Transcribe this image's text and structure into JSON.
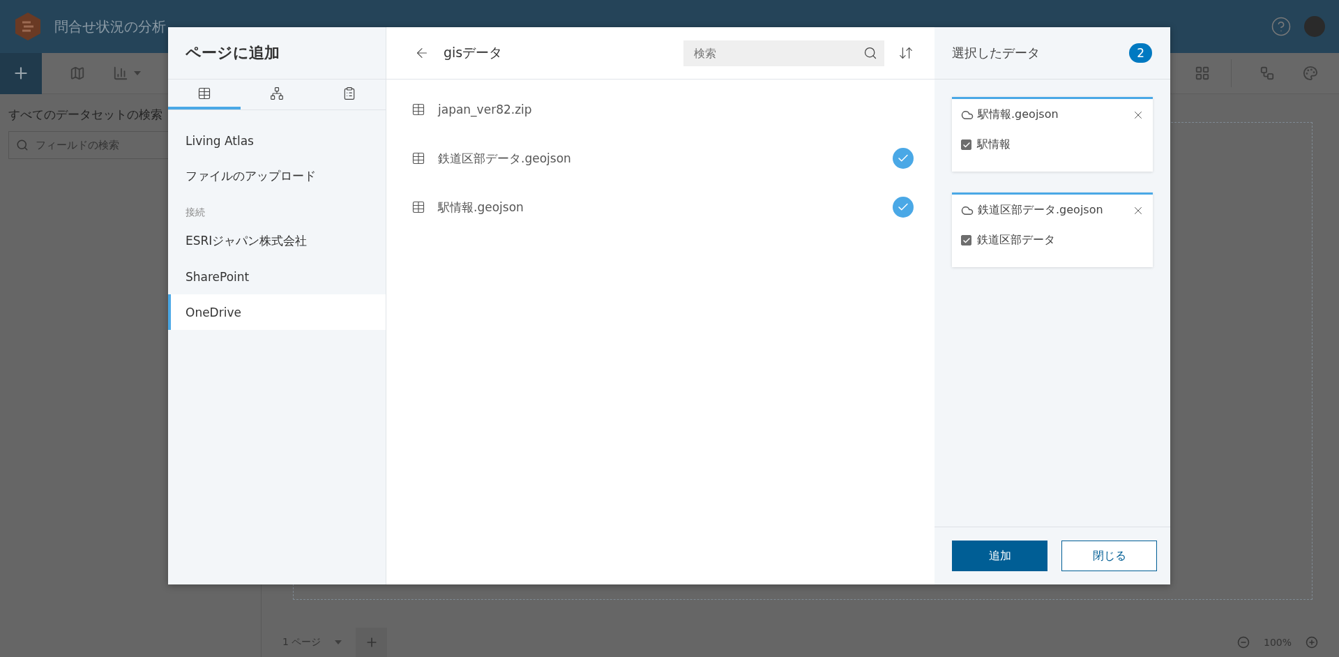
{
  "app": {
    "title": "問合せ状況の分析",
    "left_panel": {
      "heading": "すべてのデータセットの検索",
      "search_placeholder": "フィールドの検索"
    },
    "bottom_bar": {
      "page_label": "1 ページ",
      "zoom": "100%"
    }
  },
  "dialog": {
    "title": "ページに追加",
    "tabs": [
      {
        "kind": "table",
        "selected": true
      },
      {
        "kind": "hierarchy",
        "selected": false
      },
      {
        "kind": "form",
        "selected": false
      }
    ],
    "sources": [
      {
        "kind": "item",
        "label": "Living Atlas",
        "selected": false
      },
      {
        "kind": "item",
        "label": "ファイルのアップロード",
        "selected": false
      },
      {
        "kind": "heading",
        "label": "接続"
      },
      {
        "kind": "item",
        "label": "ESRIジャパン株式会社",
        "selected": false
      },
      {
        "kind": "item",
        "label": "SharePoint",
        "selected": false
      },
      {
        "kind": "item",
        "label": "OneDrive",
        "selected": true
      }
    ],
    "browser": {
      "folder": "gisデータ",
      "search_placeholder": "検索",
      "files": [
        {
          "name": "japan_ver82.zip",
          "checked": false
        },
        {
          "name": "鉄道区部データ.geojson",
          "checked": true
        },
        {
          "name": "駅情報.geojson",
          "checked": true
        }
      ]
    },
    "selected_panel": {
      "title": "選択したデータ",
      "count": "2",
      "datasets": [
        {
          "file": "駅情報.geojson",
          "layers": [
            {
              "name": "駅情報",
              "checked": true
            }
          ]
        },
        {
          "file": "鉄道区部データ.geojson",
          "layers": [
            {
              "name": "鉄道区部データ",
              "checked": true
            }
          ]
        }
      ]
    },
    "buttons": [
      {
        "label": "追加",
        "kind": "primary"
      },
      {
        "label": "閉じる",
        "kind": "secondary"
      }
    ]
  }
}
